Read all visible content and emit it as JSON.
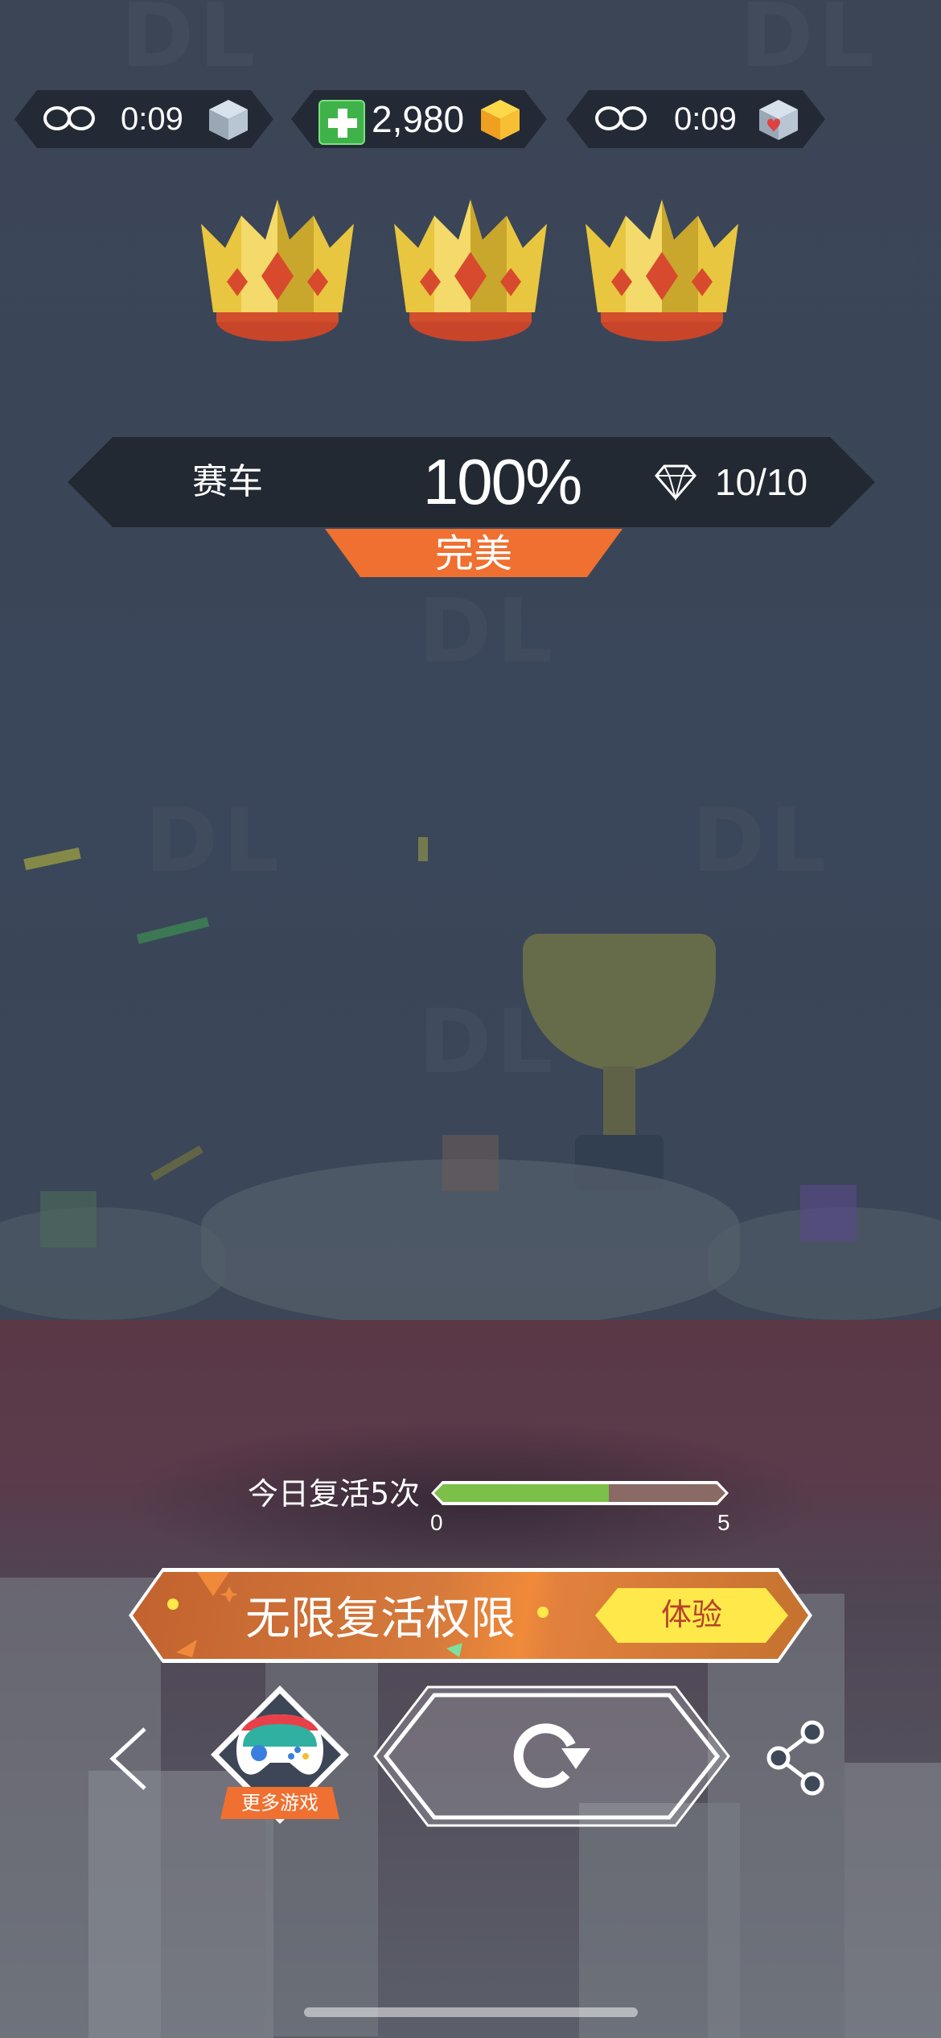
{
  "top_bar": {
    "left_timer": {
      "time": "0:09",
      "icon": "infinity-icon",
      "item_icon": "gray-cube-icon"
    },
    "coins": {
      "value": "2,980",
      "icon": "plus-icon",
      "item_icon": "gold-cube-icon"
    },
    "right_timer": {
      "time": "0:09",
      "icon": "infinity-icon",
      "item_icon": "heart-cube-icon"
    }
  },
  "crowns": [
    "crown-icon",
    "crown-icon",
    "crown-icon"
  ],
  "result": {
    "mode": "赛车",
    "percent": "100%",
    "gems": "10/10",
    "gem_icon": "diamond-icon",
    "rating": "完美"
  },
  "revive": {
    "label": "今日复活5次",
    "min": "0",
    "max": "5",
    "progress_fraction": 0.6
  },
  "banner": {
    "title": "无限复活权限",
    "button": "体验"
  },
  "bottom_nav": {
    "more_games_label": "更多游戏"
  },
  "colors": {
    "accent_orange": "#ef7030",
    "panel_dark": "#222933",
    "progress_green": "#7cc04a",
    "button_yellow": "#ffe84a"
  }
}
